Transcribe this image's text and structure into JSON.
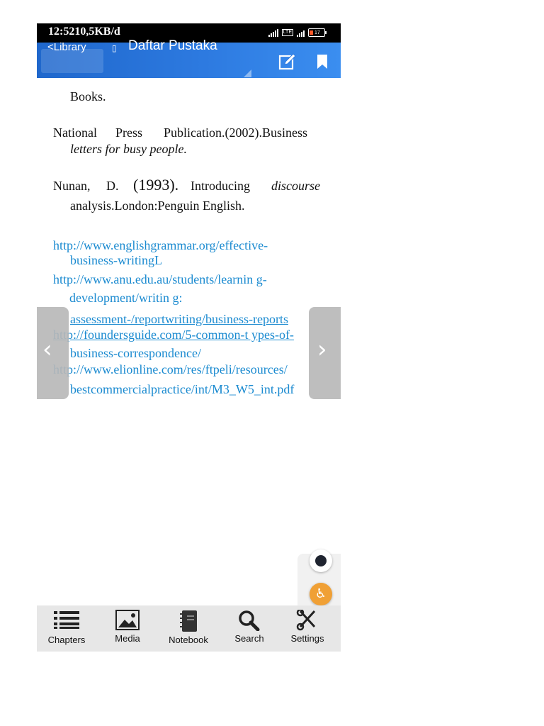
{
  "status_bar": {
    "time_speed": "12:5210,5KB/d",
    "battery": "17"
  },
  "app_bar": {
    "back_label": "<Library",
    "book_glyph": "▯",
    "title": "Daftar Pustaka"
  },
  "references": {
    "books_line": "Books.",
    "national_line1_a": "National",
    "national_line1_b": "Press",
    "national_line1_c": "Publication.(2002).Business",
    "national_line2": "letters for busy people.",
    "nunan_a": "Nunan,",
    "nunan_b": "D.",
    "nunan_c": "(1993).",
    "nunan_d": "Introducing",
    "nunan_e": "discourse",
    "nunan_line2": "analysis.London:Penguin   English."
  },
  "links": {
    "l1_line1": "http://www.englishgrammar.org/effective-",
    "l1_line2": "business-writingL",
    "l2_line1": "http://www.anu.edu.au/students/learnin  g-",
    "l2_line2": "development/writin  g:",
    "l2_line3": "assessment-/reportwriting/business-reports",
    "l3_line1": "http://foundersguide.com/5-common-t ypes-of-",
    "l3_line2": "business-correspondence/",
    "l4_line1": "http://www.elionline.com/res/ftpeli/resources/",
    "l4_line2": "bestcommercialpractice/int/M3_W5_int.pdf"
  },
  "navigation": {
    "prev_glyph": "‹",
    "next_glyph": "›"
  },
  "floating": {
    "accessibility_glyph": "♿"
  },
  "bottom_nav": {
    "chapters": "Chapters",
    "media": "Media",
    "notebook": "Notebook",
    "search": "Search",
    "settings": "Settings"
  },
  "colors": {
    "app_bar": "#2d7ae0",
    "link": "#1a8ad0",
    "accessibility": "#f0a035",
    "bottom_nav_bg": "#e7e7e7"
  }
}
